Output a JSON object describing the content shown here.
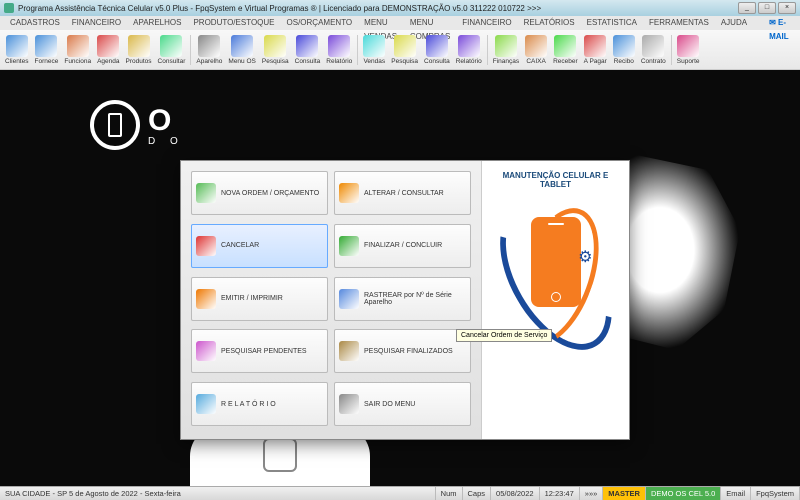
{
  "titlebar": "Programa Assistência Técnica Celular v5.0 Plus - FpqSystem e Virtual Programas ® | Licenciado para  DEMONSTRAÇÃO v5.0 311222 010722 >>>",
  "menubar": [
    "CADASTROS",
    "FINANCEIRO",
    "APARELHOS",
    "PRODUTO/ESTOQUE",
    "OS/ORÇAMENTO",
    "MENU VENDAS",
    "MENU COMPRAS",
    "FINANCEIRO",
    "RELATÓRIOS",
    "ESTATISTICA",
    "FERRAMENTAS",
    "AJUDA"
  ],
  "email_label": "E-MAIL",
  "toolbar": [
    {
      "l": "Clientes",
      "c": "#4a90d9"
    },
    {
      "l": "Fornece",
      "c": "#4a90d9"
    },
    {
      "l": "Funciona",
      "c": "#d97a4a"
    },
    {
      "l": "Agenda",
      "c": "#d94a4a"
    },
    {
      "l": "Produtos",
      "c": "#d9b84a"
    },
    {
      "l": "Consultar",
      "c": "#4ad98a"
    },
    {
      "l": "Aparelho",
      "c": "#888"
    },
    {
      "l": "Menu OS",
      "c": "#4a7ad9"
    },
    {
      "l": "Pesquisa",
      "c": "#d9d94a"
    },
    {
      "l": "Consulta",
      "c": "#4a4ad9"
    },
    {
      "l": "Relatório",
      "c": "#7a4ad9"
    },
    {
      "l": "Vendas",
      "c": "#4ad9d9"
    },
    {
      "l": "Pesquisa",
      "c": "#d9d94a"
    },
    {
      "l": "Consulta",
      "c": "#4a4ad9"
    },
    {
      "l": "Relatório",
      "c": "#7a4ad9"
    },
    {
      "l": "Finanças",
      "c": "#8ad94a"
    },
    {
      "l": "CAIXA",
      "c": "#d98a4a"
    },
    {
      "l": "Receber",
      "c": "#4ad94a"
    },
    {
      "l": "A Pagar",
      "c": "#d94a4a"
    },
    {
      "l": "Recibo",
      "c": "#4a90d9"
    },
    {
      "l": "Contrato",
      "c": "#aaa"
    },
    {
      "l": "Suporte",
      "c": "#d94a8a"
    }
  ],
  "toolbar_seps": [
    6,
    11,
    15,
    21
  ],
  "logo": {
    "main": "O",
    "sub": "D O"
  },
  "modal": {
    "title": "MANUTENÇÃO CELULAR E TABLET",
    "buttons": [
      {
        "l": "NOVA ORDEM / ORÇAMENTO",
        "c": "#5b5"
      },
      {
        "l": "ALTERAR  /  CONSULTAR",
        "c": "#e80"
      },
      {
        "l": "CANCELAR",
        "c": "#d33",
        "sel": true
      },
      {
        "l": "FINALIZAR  /  CONCLUIR",
        "c": "#3a3"
      },
      {
        "l": "EMITIR  /  IMPRIMIR",
        "c": "#e70"
      },
      {
        "l": "RASTREAR por Nº de Série Aparelho",
        "c": "#58d"
      },
      {
        "l": "PESQUISAR PENDENTES",
        "c": "#c5c"
      },
      {
        "l": "PESQUISAR FINALIZADOS",
        "c": "#a84"
      },
      {
        "l": "R E L A T Ó R I O",
        "c": "#5ad"
      },
      {
        "l": "SAIR DO MENU",
        "c": "#888"
      }
    ],
    "tooltip": "Cancelar Ordem de Serviço"
  },
  "statusbar": {
    "left": " SUA CIDADE - SP  5 de Agosto de 2022 - Sexta-feira",
    "num": "Num",
    "caps": "Caps",
    "date": "05/08/2022",
    "time": "12:23:47",
    "ord": "»»»",
    "master": "MASTER",
    "demo": "DEMO OS CEL 5.0",
    "email": "Email",
    "brand": "FpqSystem"
  }
}
